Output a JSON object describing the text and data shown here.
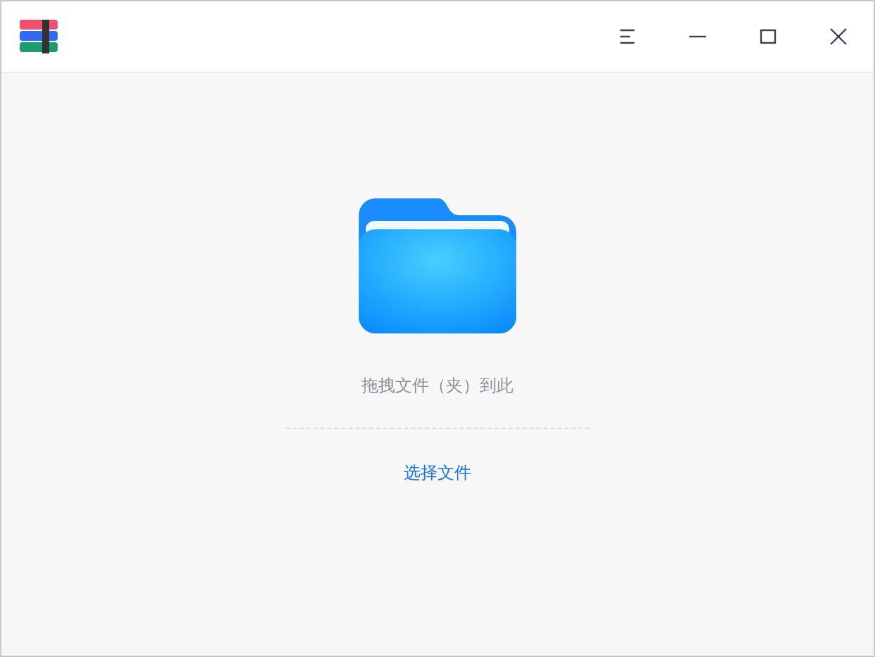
{
  "drop_area": {
    "hint": "拖拽文件（夹）到此",
    "select_link": "选择文件"
  }
}
